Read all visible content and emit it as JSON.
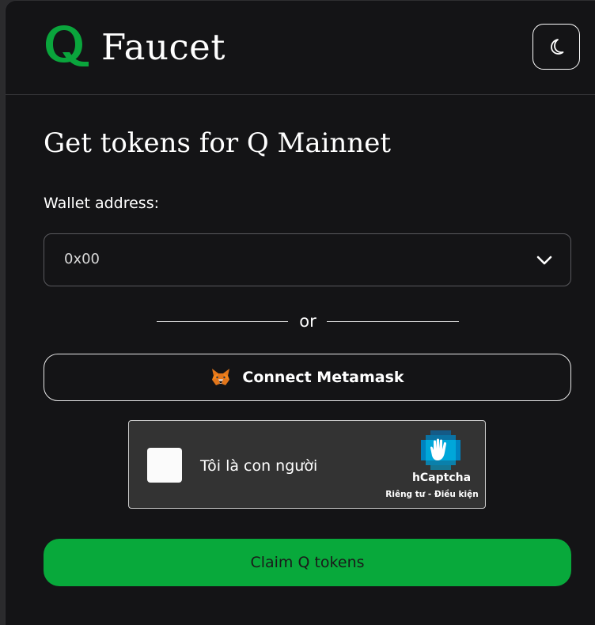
{
  "header": {
    "logo_icon": "q-logo-icon",
    "title": "Faucet",
    "theme_toggle_icon": "moon-icon"
  },
  "main": {
    "page_title": "Get tokens for Q Mainnet",
    "wallet_label": "Wallet address:",
    "wallet_value": "0x00",
    "divider_text": "or",
    "metamask_button_label": "Connect Metamask",
    "metamask_icon": "metamask-fox-icon"
  },
  "captcha": {
    "label": "Tôi là con người",
    "brand": "hCaptcha",
    "privacy_link": "Riêng tư",
    "separator": " - ",
    "terms_link": "Điều kiện"
  },
  "claim_button_label": "Claim Q tokens",
  "colors": {
    "background": "#141416",
    "accent_green": "#08a93b",
    "captcha_bg": "#333333",
    "text": "#ffffff"
  }
}
